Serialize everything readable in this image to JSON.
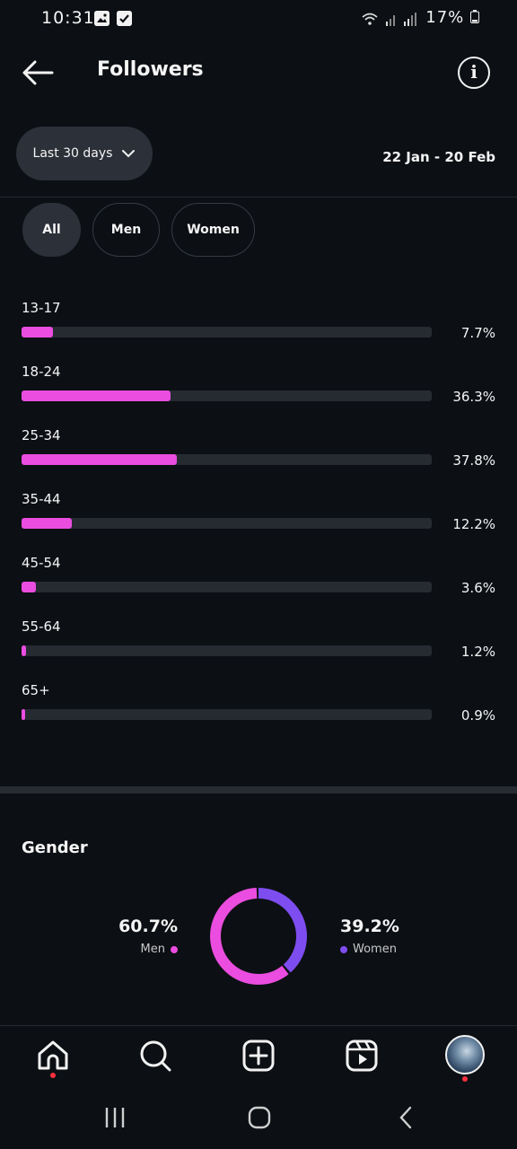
{
  "status_bar": {
    "time": "10:31",
    "battery": "17%"
  },
  "header": {
    "title": "Followers"
  },
  "filters": {
    "range_label": "Last 30 days",
    "date_range": "22 Jan - 20 Feb",
    "segments": [
      "All",
      "Men",
      "Women"
    ],
    "selected_segment": "All"
  },
  "age_ranges": [
    {
      "label": "13-17",
      "percent_text": "7.7%",
      "value": 7.7
    },
    {
      "label": "18-24",
      "percent_text": "36.3%",
      "value": 36.3
    },
    {
      "label": "25-34",
      "percent_text": "37.8%",
      "value": 37.8
    },
    {
      "label": "35-44",
      "percent_text": "12.2%",
      "value": 12.2
    },
    {
      "label": "45-54",
      "percent_text": "3.6%",
      "value": 3.6
    },
    {
      "label": "55-64",
      "percent_text": "1.2%",
      "value": 1.2
    },
    {
      "label": "65+",
      "percent_text": "0.9%",
      "value": 0.9
    }
  ],
  "gender": {
    "title": "Gender",
    "men": {
      "label": "Men",
      "percent_text": "60.7%",
      "value": 60.7,
      "color": "#ea4ddf"
    },
    "women": {
      "label": "Women",
      "percent_text": "39.2%",
      "value": 39.2,
      "color": "#7e4df0"
    }
  },
  "colors": {
    "bar_fill": "#ea4ddf",
    "track": "#262a31",
    "background": "#0c0f14"
  },
  "bottom_nav": {
    "items": [
      "home-icon",
      "search-icon",
      "create-icon",
      "reels-icon",
      "profile-avatar"
    ]
  }
}
